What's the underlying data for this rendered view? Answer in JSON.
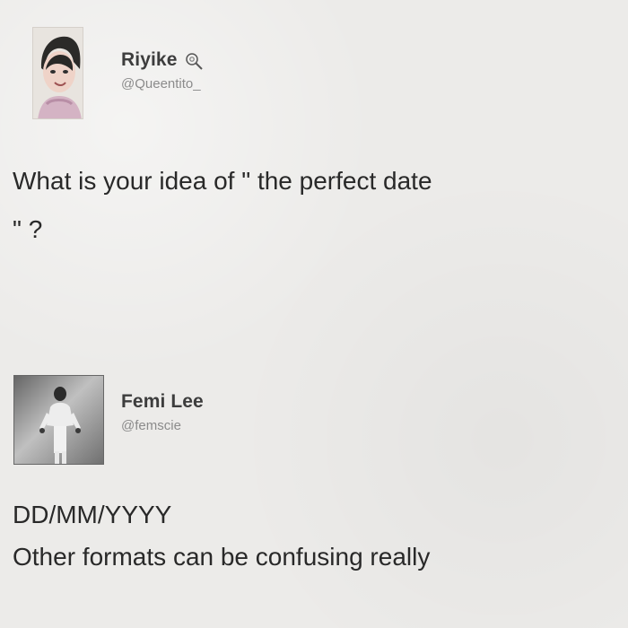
{
  "tweet": {
    "display_name": "Riyike",
    "handle": "@Queentito_",
    "text": "What is your idea of \" the perfect date\n\" ?"
  },
  "reply": {
    "display_name": "Femi Lee",
    "handle": "@femscie",
    "text_line_1": "DD/MM/YYYY",
    "text_line_2": "Other formats can be confusing really"
  },
  "icons": {
    "badge_icon": "magnifier-icon"
  }
}
